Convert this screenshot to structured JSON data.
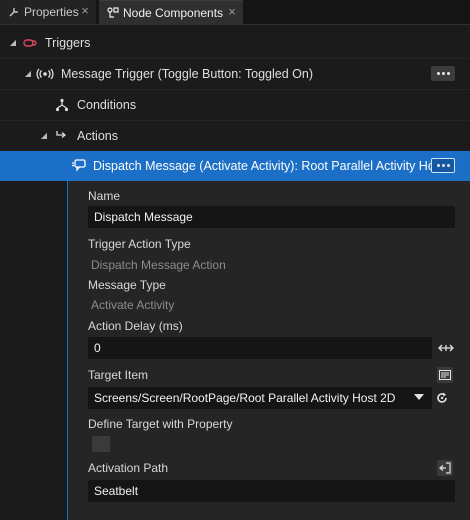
{
  "tabs": [
    {
      "label": "Properties",
      "icon": "wrench-icon"
    },
    {
      "label": "Node Components",
      "icon": "components-icon"
    }
  ],
  "tree": {
    "triggers": {
      "label": "Triggers",
      "icon": "triggers-icon"
    },
    "message_trigger": {
      "label": "Message Trigger (Toggle Button: Toggled On)",
      "icon": "message-trigger-icon"
    },
    "conditions": {
      "label": "Conditions",
      "icon": "conditions-icon"
    },
    "actions": {
      "label": "Actions",
      "icon": "actions-icon"
    },
    "dispatch": {
      "label": "Dispatch Message (Activate Activity): Root Parallel Activity Host",
      "icon": "dispatch-message-icon"
    }
  },
  "properties": {
    "name": {
      "label": "Name",
      "value": "Dispatch Message"
    },
    "trigger_action_type": {
      "label": "Trigger Action Type",
      "value": "Dispatch Message Action"
    },
    "message_type": {
      "label": "Message Type",
      "value": "Activate Activity"
    },
    "action_delay": {
      "label": "Action Delay (ms)",
      "value": "0"
    },
    "target_item": {
      "label": "Target Item",
      "value": "Screens/Screen/RootPage/Root Parallel Activity Host 2D"
    },
    "define_target": {
      "label": "Define Target with Property",
      "checked": false
    },
    "activation_path": {
      "label": "Activation Path",
      "value": "Seatbelt"
    }
  },
  "colors": {
    "accent": "#1c6fc6",
    "background": "#1b1b1b",
    "panel": "#252525",
    "field": "#151515"
  }
}
